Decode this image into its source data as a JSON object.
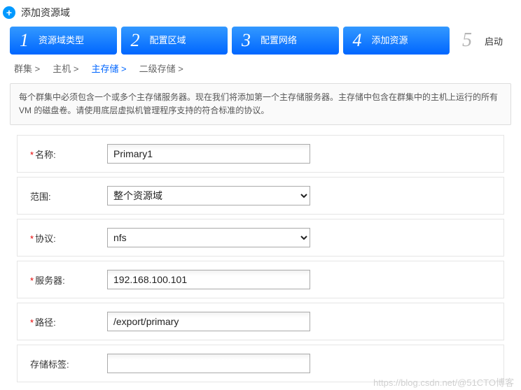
{
  "header": {
    "title": "添加资源域"
  },
  "steps": [
    {
      "num": "1",
      "label": "资源域类型"
    },
    {
      "num": "2",
      "label": "配置区域"
    },
    {
      "num": "3",
      "label": "配置网络"
    },
    {
      "num": "4",
      "label": "添加资源"
    }
  ],
  "step5": {
    "num": "5",
    "label": "启动"
  },
  "breadcrumb": {
    "items": [
      {
        "label": "群集 >",
        "active": false
      },
      {
        "label": "主机 >",
        "active": false
      },
      {
        "label": "主存储 >",
        "active": true
      },
      {
        "label": "二级存储 >",
        "active": false
      }
    ]
  },
  "description": "每个群集中必须包含一个或多个主存储服务器。现在我们将添加第一个主存储服务器。主存储中包含在群集中的主机上运行的所有 VM 的磁盘卷。请使用底层虚拟机管理程序支持的符合标准的协议。",
  "form": {
    "name": {
      "label": "名称:",
      "value": "Primary1",
      "required": true
    },
    "scope": {
      "label": "范围:",
      "value": "整个资源域",
      "required": false
    },
    "protocol": {
      "label": "协议:",
      "value": "nfs",
      "required": true
    },
    "server": {
      "label": "服务器:",
      "value": "192.168.100.101",
      "required": true
    },
    "path": {
      "label": "路径:",
      "value": "/export/primary",
      "required": true
    },
    "tag": {
      "label": "存储标签:",
      "value": "",
      "required": false
    }
  },
  "watermark": "https://blog.csdn.net/@51CTO博客"
}
